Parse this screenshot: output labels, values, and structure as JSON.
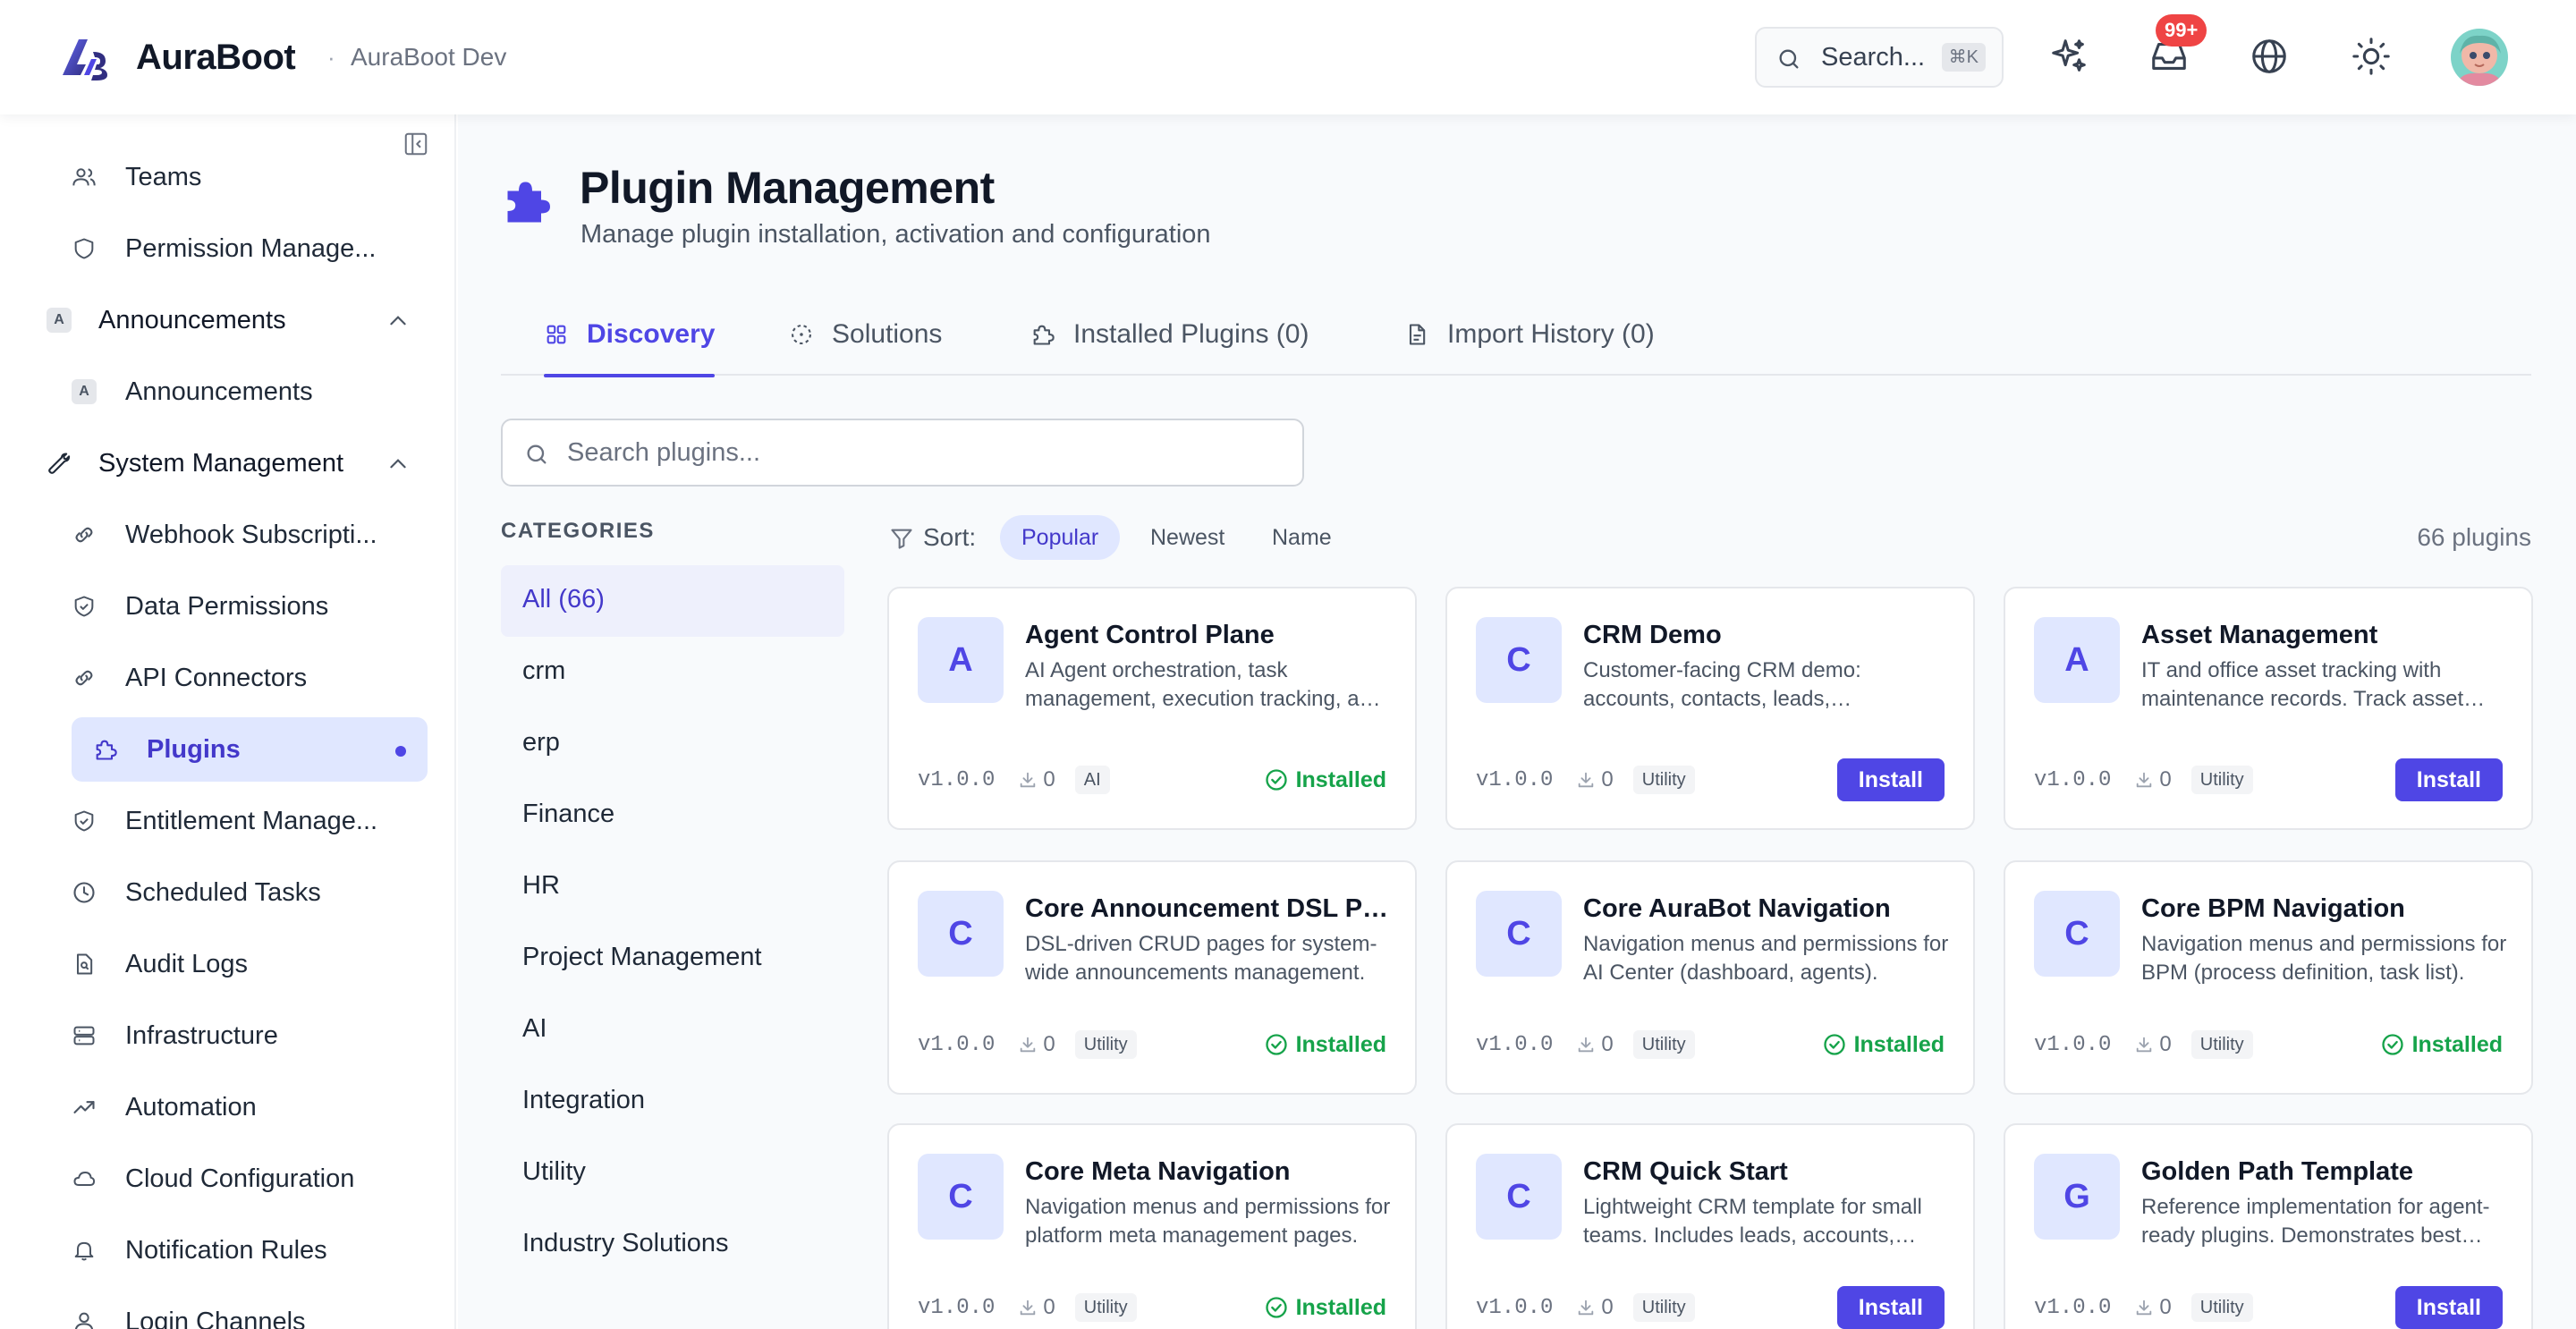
{
  "header": {
    "brand": "AuraBoot",
    "separator": "·",
    "environment": "AuraBoot Dev",
    "search_label": "Search...",
    "search_shortcut": "⌘K",
    "notification_badge": "99+",
    "icons": [
      "sparkles-icon",
      "inbox-icon",
      "globe-icon",
      "sun-icon",
      "avatar"
    ]
  },
  "sidebar": {
    "items": [
      {
        "label": "Teams",
        "icon": "users-icon",
        "type": "child"
      },
      {
        "label": "Permission Manage...",
        "icon": "shield-icon",
        "type": "child"
      },
      {
        "label": "Announcements",
        "icon": "A",
        "type": "group",
        "expanded": true
      },
      {
        "label": "Announcements",
        "icon": "A",
        "type": "child"
      },
      {
        "label": "System Management",
        "icon": "wrench-icon",
        "type": "group",
        "expanded": true
      },
      {
        "label": "Webhook Subscripti...",
        "icon": "link-icon",
        "type": "child"
      },
      {
        "label": "Data Permissions",
        "icon": "shield-check-icon",
        "type": "child"
      },
      {
        "label": "API Connectors",
        "icon": "link-icon",
        "type": "child"
      },
      {
        "label": "Plugins",
        "icon": "puzzle-icon",
        "type": "child",
        "active": true
      },
      {
        "label": "Entitlement Manage...",
        "icon": "shield-check-icon",
        "type": "child"
      },
      {
        "label": "Scheduled Tasks",
        "icon": "clock-icon",
        "type": "child"
      },
      {
        "label": "Audit Logs",
        "icon": "file-search-icon",
        "type": "child"
      },
      {
        "label": "Infrastructure",
        "icon": "server-icon",
        "type": "child"
      },
      {
        "label": "Automation",
        "icon": "trending-icon",
        "type": "child"
      },
      {
        "label": "Cloud Configuration",
        "icon": "cloud-icon",
        "type": "child"
      },
      {
        "label": "Notification Rules",
        "icon": "bell-icon",
        "type": "child"
      },
      {
        "label": "Login Channels",
        "icon": "user-icon",
        "type": "child"
      }
    ]
  },
  "page": {
    "title": "Plugin Management",
    "subtitle": "Manage plugin installation, activation and configuration"
  },
  "tabs": [
    {
      "label": "Discovery",
      "icon": "grid-icon",
      "active": true
    },
    {
      "label": "Solutions",
      "icon": "dashed-circle-icon",
      "active": false
    },
    {
      "label": "Installed Plugins (0)",
      "icon": "puzzle-icon",
      "active": false
    },
    {
      "label": "Import History (0)",
      "icon": "file-icon",
      "active": false
    }
  ],
  "search": {
    "placeholder": "Search plugins..."
  },
  "categories": {
    "heading": "CATEGORIES",
    "items": [
      "All (66)",
      "crm",
      "erp",
      "Finance",
      "HR",
      "Project Management",
      "AI",
      "Integration",
      "Utility",
      "Industry Solutions"
    ],
    "active_index": 0
  },
  "sort": {
    "label": "Sort:",
    "options": [
      "Popular",
      "Newest",
      "Name"
    ],
    "active": "Popular",
    "count_label": "66 plugins"
  },
  "plugins": [
    {
      "letter": "A",
      "name": "Agent Control Plane",
      "description": "AI Agent orchestration, task management, execution tracking, and monitoring.",
      "version": "v1.0.0",
      "downloads": "0",
      "tag": "AI",
      "status": "installed",
      "status_label": "Installed"
    },
    {
      "letter": "C",
      "name": "CRM Demo",
      "description": "Customer-facing CRM demo: accounts, contacts, leads, opportunities.",
      "version": "v1.0.0",
      "downloads": "0",
      "tag": "Utility",
      "status": "install",
      "status_label": "Install"
    },
    {
      "letter": "A",
      "name": "Asset Management",
      "description": "IT and office asset tracking with maintenance records. Track asset lifecycle.",
      "version": "v1.0.0",
      "downloads": "0",
      "tag": "Utility",
      "status": "install",
      "status_label": "Install"
    },
    {
      "letter": "C",
      "name": "Core Announcement DSL Pages",
      "description": "DSL-driven CRUD pages for system-wide announcements management.",
      "version": "v1.0.0",
      "downloads": "0",
      "tag": "Utility",
      "status": "installed",
      "status_label": "Installed"
    },
    {
      "letter": "C",
      "name": "Core AuraBot Navigation",
      "description": "Navigation menus and permissions for AI Center (dashboard, agents).",
      "version": "v1.0.0",
      "downloads": "0",
      "tag": "Utility",
      "status": "installed",
      "status_label": "Installed"
    },
    {
      "letter": "C",
      "name": "Core BPM Navigation",
      "description": "Navigation menus and permissions for BPM (process definition, task list).",
      "version": "v1.0.0",
      "downloads": "0",
      "tag": "Utility",
      "status": "installed",
      "status_label": "Installed"
    },
    {
      "letter": "C",
      "name": "Core Meta Navigation",
      "description": "Navigation menus and permissions for platform meta management pages.",
      "version": "v1.0.0",
      "downloads": "0",
      "tag": "Utility",
      "status": "installed",
      "status_label": "Installed"
    },
    {
      "letter": "C",
      "name": "CRM Quick Start",
      "description": "Lightweight CRM template for small teams. Includes leads, accounts, deals.",
      "version": "v1.0.0",
      "downloads": "0",
      "tag": "Utility",
      "status": "install",
      "status_label": "Install"
    },
    {
      "letter": "G",
      "name": "Golden Path Template",
      "description": "Reference implementation for agent-ready plugins. Demonstrates best practices.",
      "version": "v1.0.0",
      "downloads": "0",
      "tag": "Utility",
      "status": "install",
      "status_label": "Install"
    }
  ],
  "colors": {
    "accent": "#4f46e5",
    "accent_soft": "#e0e7ff",
    "success": "#16a34a",
    "badge": "#ef4444"
  }
}
